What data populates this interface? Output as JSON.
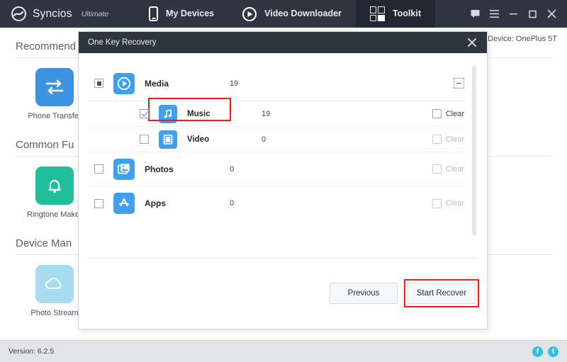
{
  "titlebar": {
    "brand": "Syncios",
    "brand_suffix": "Ultimate",
    "brand_logo_icon": "syncios-logo-icon",
    "tabs": [
      {
        "label": "My Devices",
        "icon": "phone-icon",
        "active": false
      },
      {
        "label": "Video Downloader",
        "icon": "play-circle-icon",
        "active": false
      },
      {
        "label": "Toolkit",
        "icon": "grid-icon",
        "active": true
      }
    ],
    "window_controls": [
      {
        "name": "feedback-icon",
        "glyph": "chat-bubble"
      },
      {
        "name": "menu-icon",
        "glyph": "hamburger"
      },
      {
        "name": "minimize-icon",
        "glyph": "minus"
      },
      {
        "name": "maximize-icon",
        "glyph": "square"
      },
      {
        "name": "close-icon",
        "glyph": "cross"
      }
    ]
  },
  "page": {
    "device_label": "Device: OnePlus 5T",
    "sections": [
      {
        "title": "Recommend",
        "tiles": [
          {
            "label": "Phone Transfer",
            "icon": "transfer-arrows-icon",
            "color": "#3d93e0"
          }
        ]
      },
      {
        "title": "Common Fu",
        "tiles": [
          {
            "label": "Ringtone Maker",
            "icon": "bell-icon",
            "color": "#1fbf9c"
          }
        ]
      },
      {
        "title": "Device Man",
        "tiles": [
          {
            "label": "Photo Stream",
            "icon": "cloud-icon",
            "color": "#a8dcf0"
          }
        ]
      }
    ]
  },
  "modal": {
    "title": "One Key Recovery",
    "close_icon": "close-icon",
    "rows": [
      {
        "label": "Media",
        "count": "19",
        "icon": "play-circle-icon",
        "checkbox_state": "indeterminate",
        "level": "parent",
        "right_control": "collapse-icon",
        "clear_label": "",
        "clear_enabled": false
      },
      {
        "label": "Music",
        "count": "19",
        "icon": "music-note-icon",
        "checkbox_state": "checked",
        "level": "child",
        "right_control": "clear-checkbox",
        "clear_label": "Clear",
        "clear_enabled": true,
        "highlighted": true
      },
      {
        "label": "Video",
        "count": "0",
        "icon": "film-strip-icon",
        "checkbox_state": "unchecked",
        "level": "child",
        "right_control": "clear-checkbox",
        "clear_label": "Clear",
        "clear_enabled": false
      },
      {
        "label": "Photos",
        "count": "0",
        "icon": "photo-icon",
        "checkbox_state": "unchecked",
        "level": "parent",
        "right_control": "clear-checkbox",
        "clear_label": "Clear",
        "clear_enabled": false
      },
      {
        "label": "Apps",
        "count": "0",
        "icon": "app-store-icon",
        "checkbox_state": "unchecked",
        "level": "parent",
        "right_control": "clear-checkbox",
        "clear_label": "Clear",
        "clear_enabled": false
      }
    ],
    "buttons": {
      "previous": "Previous",
      "start_recover": "Start Recover"
    }
  },
  "statusbar": {
    "version": "Version: 6.2.5",
    "social": [
      {
        "name": "facebook-icon",
        "glyph": "f"
      },
      {
        "name": "twitter-icon",
        "glyph": "t"
      }
    ]
  },
  "colors": {
    "accent": "#3fa0ef",
    "titlebar": "#2f3640",
    "highlight": "#ee1c1c"
  }
}
